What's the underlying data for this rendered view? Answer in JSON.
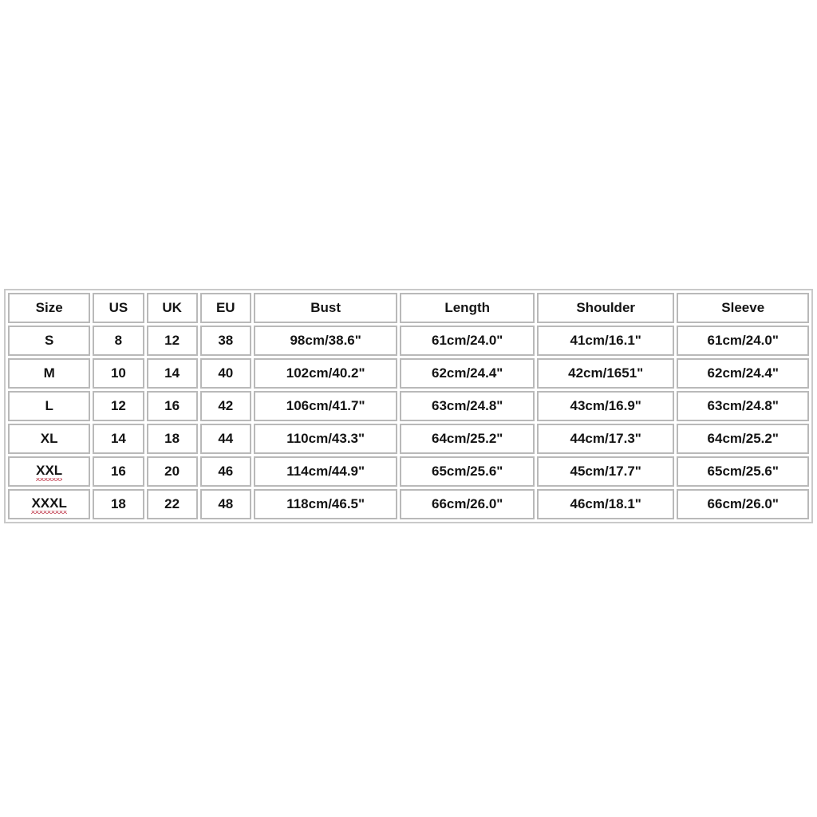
{
  "table": {
    "name": "size-chart",
    "columns": [
      "Size",
      "US",
      "UK",
      "EU",
      "Bust",
      "Length",
      "Shoulder",
      "Sleeve"
    ],
    "rows": [
      {
        "size": "S",
        "size_misspelled": false,
        "us": "8",
        "uk": "12",
        "eu": "38",
        "bust": "98cm/38.6\"",
        "length": "61cm/24.0\"",
        "shoulder": "41cm/16.1\"",
        "sleeve": "61cm/24.0\""
      },
      {
        "size": "M",
        "size_misspelled": false,
        "us": "10",
        "uk": "14",
        "eu": "40",
        "bust": "102cm/40.2\"",
        "length": "62cm/24.4\"",
        "shoulder": "42cm/1651\"",
        "sleeve": "62cm/24.4\""
      },
      {
        "size": "L",
        "size_misspelled": false,
        "us": "12",
        "uk": "16",
        "eu": "42",
        "bust": "106cm/41.7\"",
        "length": "63cm/24.8\"",
        "shoulder": "43cm/16.9\"",
        "sleeve": "63cm/24.8\""
      },
      {
        "size": "XL",
        "size_misspelled": false,
        "us": "14",
        "uk": "18",
        "eu": "44",
        "bust": "110cm/43.3\"",
        "length": "64cm/25.2\"",
        "shoulder": "44cm/17.3\"",
        "sleeve": "64cm/25.2\""
      },
      {
        "size": "XXL",
        "size_misspelled": true,
        "us": "16",
        "uk": "20",
        "eu": "46",
        "bust": "114cm/44.9\"",
        "length": "65cm/25.6\"",
        "shoulder": "45cm/17.7\"",
        "sleeve": "65cm/25.6\""
      },
      {
        "size": "XXXL",
        "size_misspelled": true,
        "us": "18",
        "uk": "22",
        "eu": "48",
        "bust": "118cm/46.5\"",
        "length": "66cm/26.0\"",
        "shoulder": "46cm/18.1\"",
        "sleeve": "66cm/26.0\""
      }
    ]
  },
  "colors": {
    "page_background": "#ffffff",
    "cell_background": "#ffffff",
    "cell_border": "#b9b9b9",
    "table_border": "#c9c9c9",
    "text": "#141414",
    "spellcheck_underline": "#c0394b"
  }
}
